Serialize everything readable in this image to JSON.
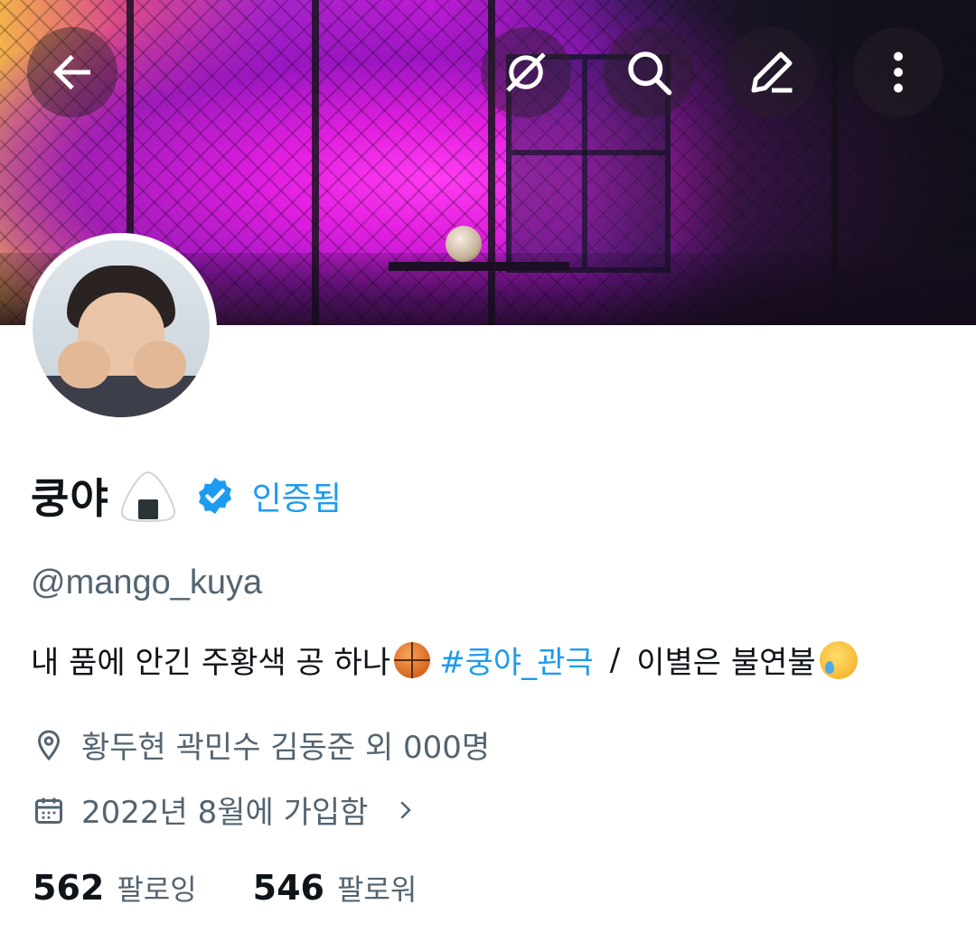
{
  "profile": {
    "display_name": "쿵야",
    "verified_label": "인증됨",
    "handle": "@mango_kuya",
    "bio": {
      "text": "내 품에 안긴 주황색 공 하나",
      "hashtag": "#쿵야_관극",
      "separator": "/",
      "text2": "이별은 불연불"
    },
    "location": "황두현 곽민수 김동준 외 000명",
    "joined": "2022년 8월에 가입함",
    "following_count": "562",
    "following_label": "팔로잉",
    "followers_count": "546",
    "followers_label": "팔로워"
  },
  "icons": {
    "back": "arrow-left-icon",
    "hide": "eye-off-icon",
    "search": "search-icon",
    "edit": "pencil-icon",
    "more": "more-vertical-icon",
    "verified": "verified-badge-icon",
    "location": "map-pin-icon",
    "calendar": "calendar-icon"
  },
  "colors": {
    "accent": "#1d9bf0",
    "secondary_text": "#536471",
    "primary_text": "#0f1419"
  }
}
